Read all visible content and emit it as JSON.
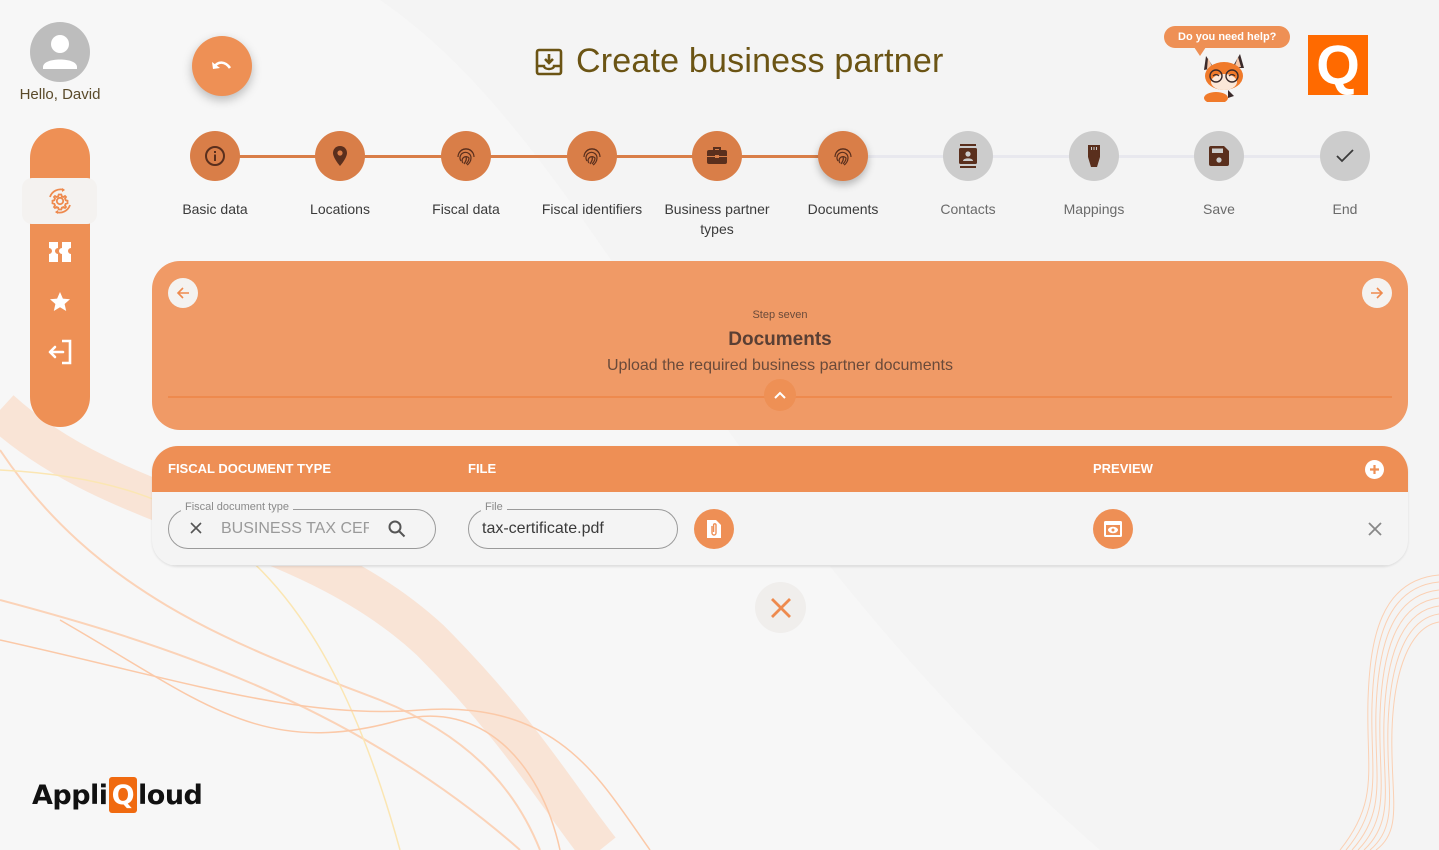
{
  "user": {
    "greeting": "Hello, David",
    "avatar_icon": "person-icon"
  },
  "sidebar": {
    "items": [
      {
        "name": "settings-sync",
        "icon": "gear-sync-icon",
        "active": true
      },
      {
        "name": "tickets",
        "icon": "ticket-icon",
        "active": false
      },
      {
        "name": "favorites",
        "icon": "star-icon",
        "active": false
      },
      {
        "name": "logout",
        "icon": "logout-icon",
        "active": false
      }
    ]
  },
  "header": {
    "back_icon": "undo-icon",
    "title": "Create business partner",
    "title_icon": "inbox-download-icon",
    "help_text": "Do you need help?",
    "logo_letter": "Q"
  },
  "stepper": {
    "steps": [
      {
        "label": "Basic data",
        "icon": "info-icon",
        "state": "done"
      },
      {
        "label": "Locations",
        "icon": "location-pin-icon",
        "state": "done"
      },
      {
        "label": "Fiscal data",
        "icon": "fingerprint-icon",
        "state": "done"
      },
      {
        "label": "Fiscal identifiers",
        "icon": "fingerprint-icon",
        "state": "done"
      },
      {
        "label": "Business partner types",
        "icon": "briefcase-icon",
        "state": "done"
      },
      {
        "label": "Documents",
        "icon": "fingerprint-icon",
        "state": "current"
      },
      {
        "label": "Contacts",
        "icon": "contact-card-icon",
        "state": "todo"
      },
      {
        "label": "Mappings",
        "icon": "ethernet-plug-icon",
        "state": "todo"
      },
      {
        "label": "Save",
        "icon": "floppy-disk-icon",
        "state": "todo"
      },
      {
        "label": "End",
        "icon": "check-icon",
        "state": "todo"
      }
    ]
  },
  "panel": {
    "step_number": "Step seven",
    "title": "Documents",
    "description": "Upload the required business partner documents"
  },
  "table": {
    "columns": [
      "FISCAL DOCUMENT TYPE",
      "FILE",
      "PREVIEW"
    ],
    "rows": [
      {
        "doc_type_label": "Fiscal document type",
        "doc_type_value": "BUSINESS TAX CERTIFICATE",
        "file_label": "File",
        "file_value": "tax-certificate.pdf"
      }
    ]
  },
  "footer": {
    "brand_prefix": "Appli",
    "brand_q": "Q",
    "brand_suffix": "loud"
  },
  "colors": {
    "accent": "#ee9055",
    "step_done": "#d97e48",
    "step_todo": "#cccccc",
    "icon_dark": "#5a2f1d",
    "title_color": "#6b5414",
    "logo_orange": "#ff6a00"
  }
}
